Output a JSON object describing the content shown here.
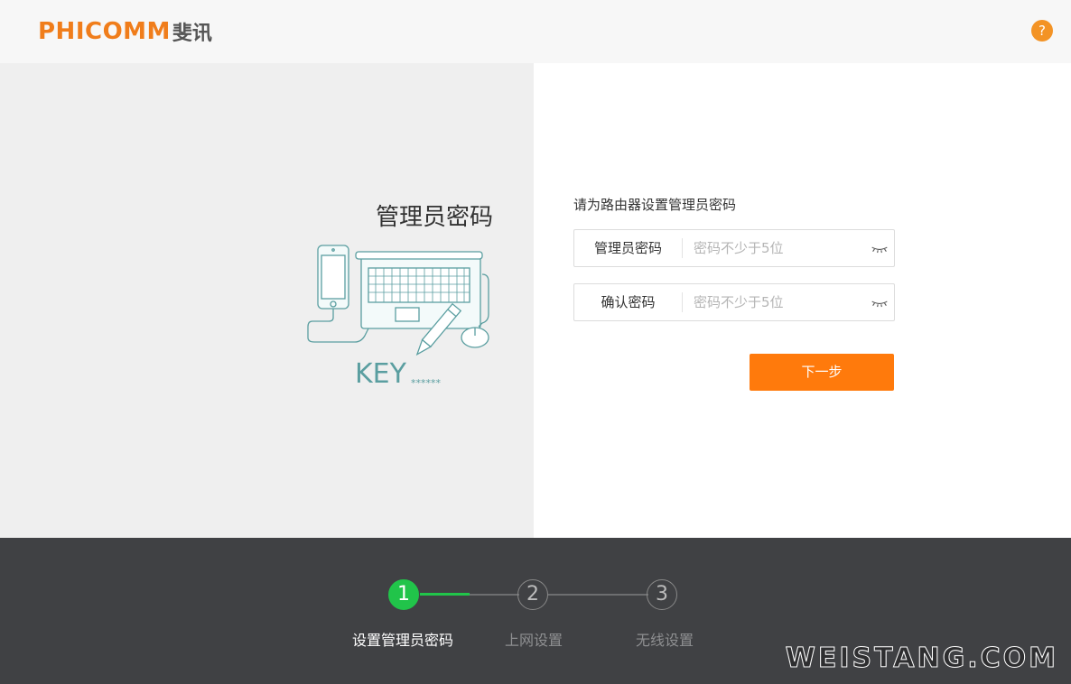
{
  "header": {
    "logo_en": "PHICOMM",
    "logo_cn": "斐讯",
    "help_icon": "?"
  },
  "left": {
    "title": "管理员密码",
    "illustration": {
      "key_text": "KEY",
      "key_stars": "******"
    }
  },
  "form": {
    "prompt": "请为路由器设置管理员密码",
    "fields": [
      {
        "label": "管理员密码",
        "placeholder": "密码不少于5位",
        "value": ""
      },
      {
        "label": "确认密码",
        "placeholder": "密码不少于5位",
        "value": ""
      }
    ],
    "next_label": "下一步"
  },
  "steps": [
    {
      "number": "1",
      "label": "设置管理员密码",
      "active": true
    },
    {
      "number": "2",
      "label": "上网设置",
      "active": false
    },
    {
      "number": "3",
      "label": "无线设置",
      "active": false
    }
  ],
  "watermark": "WEISTANG.COM",
  "colors": {
    "brand_orange": "#f07d1b",
    "button_orange": "#ff7a0c",
    "step_active_green": "#21c44a",
    "footer_bg": "#404144",
    "illustration_teal": "#5a9ea0"
  }
}
